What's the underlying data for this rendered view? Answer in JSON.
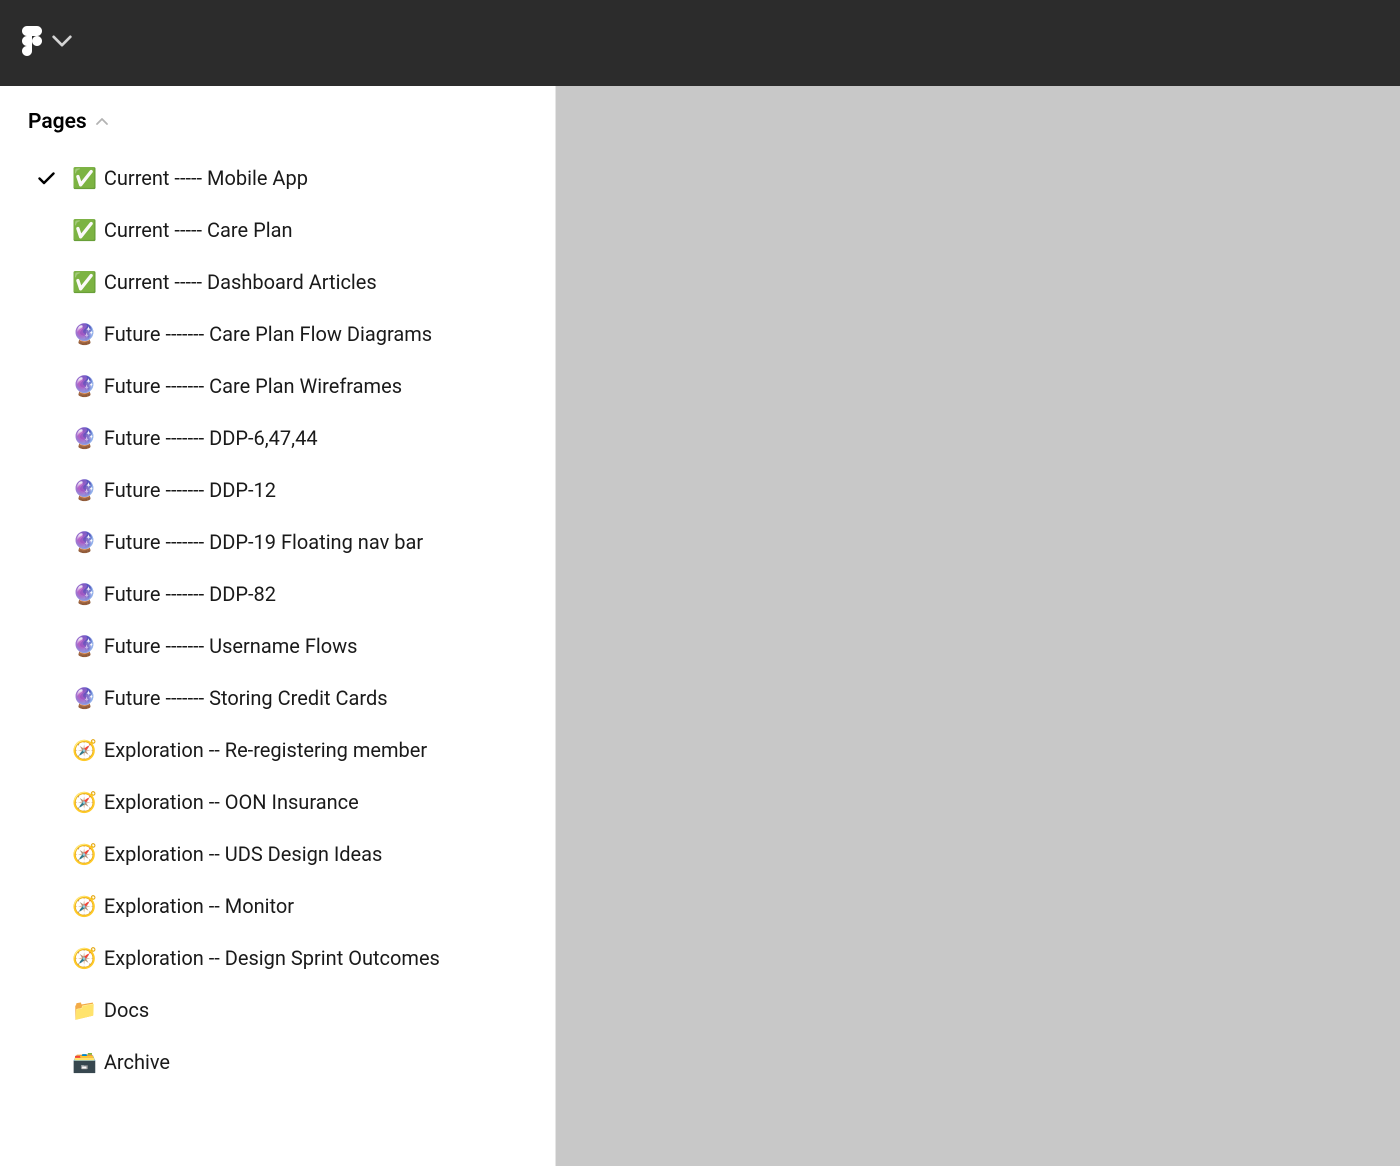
{
  "sidebar": {
    "header_label": "Pages",
    "pages": [
      {
        "emoji": "✅",
        "label": "Current ----- Mobile App",
        "selected": true
      },
      {
        "emoji": "✅",
        "label": "Current ----- Care Plan",
        "selected": false
      },
      {
        "emoji": "✅",
        "label": "Current ----- Dashboard Articles",
        "selected": false
      },
      {
        "emoji": "🔮",
        "label": "Future ------- Care Plan Flow Diagrams",
        "selected": false
      },
      {
        "emoji": "🔮",
        "label": "Future ------- Care Plan Wireframes",
        "selected": false
      },
      {
        "emoji": "🔮",
        "label": "Future ------- DDP-6,47,44",
        "selected": false
      },
      {
        "emoji": "🔮",
        "label": "Future ------- DDP-12",
        "selected": false
      },
      {
        "emoji": "🔮",
        "label": "Future ------- DDP-19 Floating nav bar",
        "selected": false
      },
      {
        "emoji": "🔮",
        "label": "Future ------- DDP-82",
        "selected": false
      },
      {
        "emoji": "🔮",
        "label": "Future -------  Username Flows",
        "selected": false
      },
      {
        "emoji": "🔮",
        "label": "Future ------- Storing Credit Cards",
        "selected": false
      },
      {
        "emoji": "🧭",
        "label": "Exploration -- Re-registering member",
        "selected": false
      },
      {
        "emoji": "🧭",
        "label": "Exploration -- OON Insurance",
        "selected": false
      },
      {
        "emoji": "🧭",
        "label": "Exploration -- UDS Design Ideas",
        "selected": false
      },
      {
        "emoji": "🧭",
        "label": "Exploration -- Monitor",
        "selected": false
      },
      {
        "emoji": "🧭",
        "label": "Exploration -- Design Sprint Outcomes",
        "selected": false
      },
      {
        "emoji": "📁",
        "label": "Docs",
        "selected": false
      },
      {
        "emoji": "🗃️",
        "label": "Archive",
        "selected": false
      }
    ]
  }
}
